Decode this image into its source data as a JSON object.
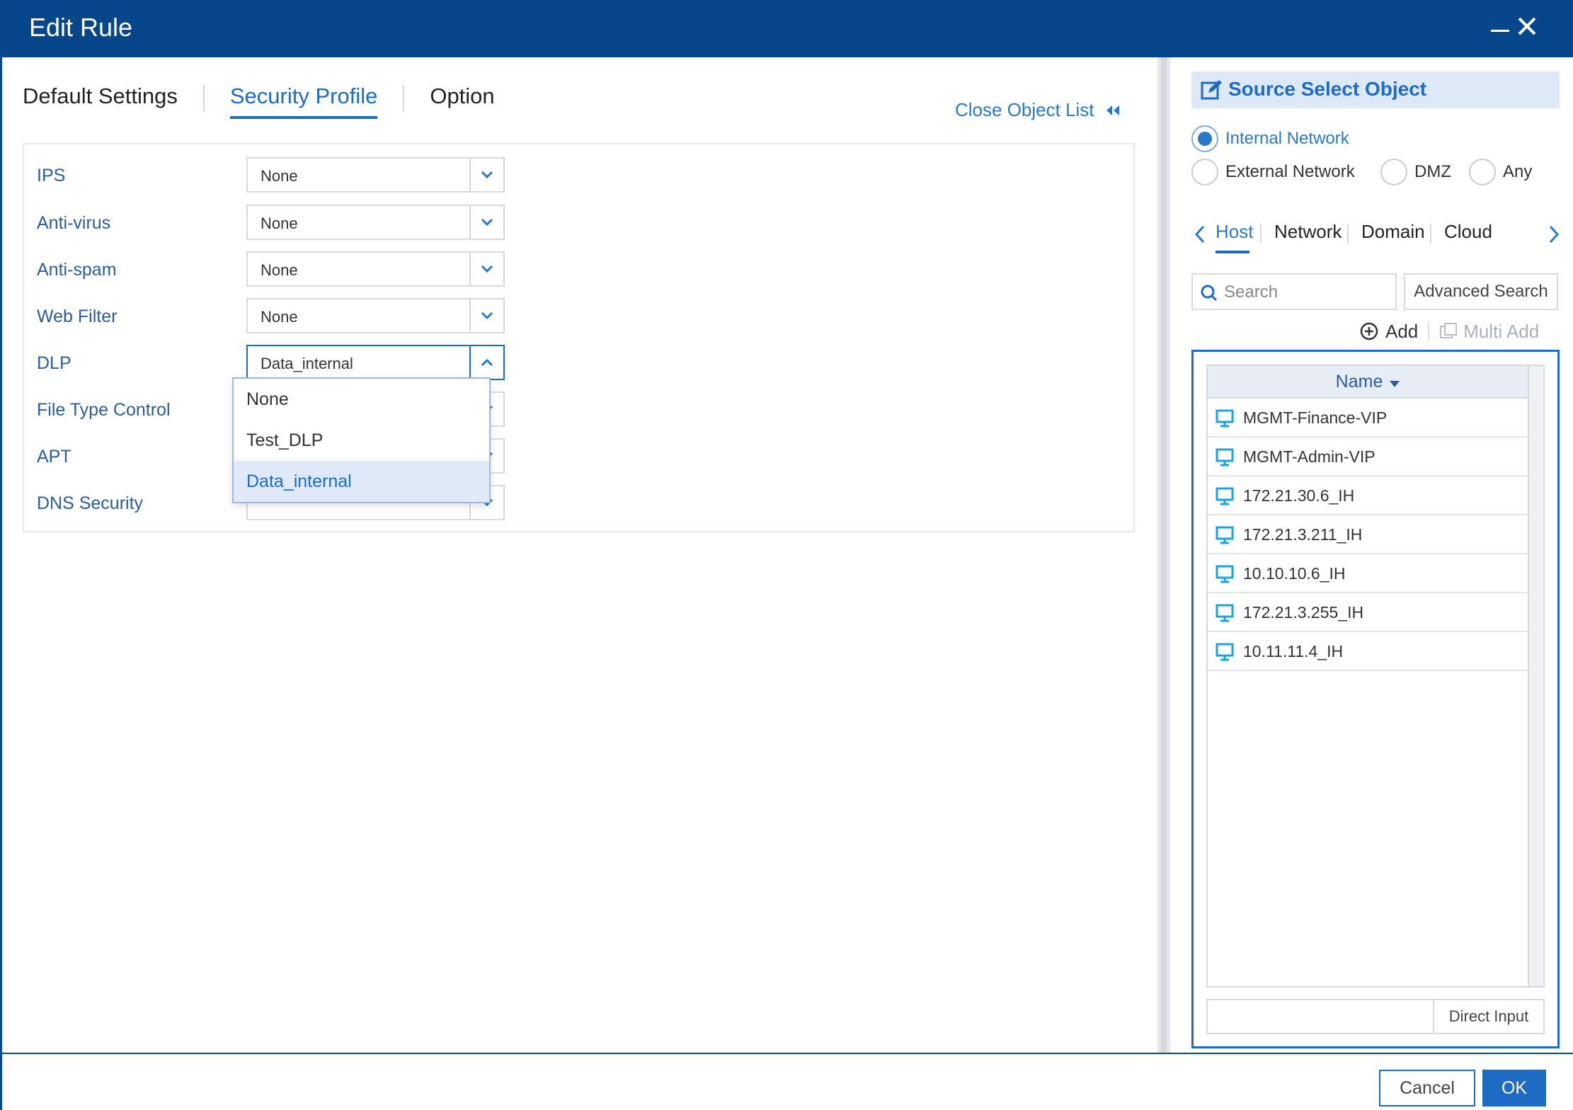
{
  "window": {
    "title": "Edit Rule"
  },
  "tabs": [
    {
      "label": "Default Settings"
    },
    {
      "label": "Security Profile"
    },
    {
      "label": "Option"
    }
  ],
  "close_object_list": "Close Object List",
  "profiles": [
    {
      "label": "IPS",
      "value": "None"
    },
    {
      "label": "Anti-virus",
      "value": "None"
    },
    {
      "label": "Anti-spam",
      "value": "None"
    },
    {
      "label": "Web Filter",
      "value": "None"
    },
    {
      "label": "DLP",
      "value": "Data_internal"
    },
    {
      "label": "File Type Control",
      "value": ""
    },
    {
      "label": "APT",
      "value": ""
    },
    {
      "label": "DNS Security",
      "value": ""
    }
  ],
  "dlp_dropdown": {
    "options": [
      "None",
      "Test_DLP",
      "Data_internal"
    ],
    "selected": "Data_internal"
  },
  "object_panel": {
    "title": "Source Select Object",
    "zones": [
      "Internal Network",
      "External Network",
      "DMZ",
      "Any"
    ],
    "selected_zone": "Internal Network",
    "object_tabs": [
      "Host",
      "Network",
      "Domain",
      "Cloud"
    ],
    "active_object_tab": "Host",
    "search_placeholder": "Search",
    "advanced_search": "Advanced Search",
    "add": "Add",
    "multi_add": "Multi Add",
    "column_name": "Name",
    "items": [
      "MGMT-Finance-VIP",
      "MGMT-Admin-VIP",
      "172.21.30.6_IH",
      "172.21.3.211_IH",
      "10.10.10.6_IH",
      "172.21.3.255_IH",
      "10.11.11.4_IH"
    ],
    "direct_input": "Direct Input"
  },
  "footer": {
    "cancel": "Cancel",
    "ok": "OK"
  },
  "colors": {
    "titlebar": "#08468c",
    "accent": "#1e6bc4",
    "selected_row": "#dfe9f7",
    "panel_header": "#dde9f6"
  }
}
